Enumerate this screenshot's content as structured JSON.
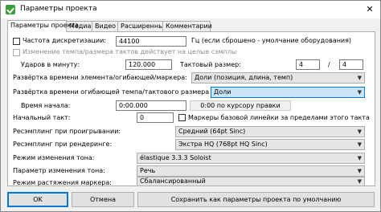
{
  "window": {
    "title": "Параметры проекта",
    "close": "✕"
  },
  "tabs": [
    "Параметры проекта",
    "Медиа",
    "Видео",
    "Расширенные",
    "Комментарии"
  ],
  "sample_rate": {
    "label": "Частота дискретизации:",
    "value": "44100",
    "hz_note": "Гц (если сброшено - умолчание оборудования)"
  },
  "tempo_change_note": "Изменение темпа/размера тактов действует на целые сэмплы",
  "bpm": {
    "label": "Ударов в минуту:",
    "value": "120.000"
  },
  "time_sig": {
    "label": "Тактовый размер:",
    "numerator": "4",
    "slash": "/",
    "denominator": "4"
  },
  "item_timebase": {
    "label": "Развёртка времени элемента/огибающей/маркера:",
    "value": "Доли (позиция, длина, темп)"
  },
  "envelope_timebase": {
    "label": "Развёртка времени огибающей темпа/тактового размера",
    "value": "Доли"
  },
  "start_time": {
    "label": "Время начала:",
    "value": "0:00.000",
    "button": "0:00 по курсору правки"
  },
  "start_measure": {
    "label": "Начальный такт:",
    "value": "0",
    "checkbox_label": "Маркеры базовой линейки за пределами этого такта"
  },
  "resample_play": {
    "label": "Ресэмплинг при проигрывании:",
    "value": "Средний (64pt Sinc)"
  },
  "resample_render": {
    "label": "Ресэмплинг при рендеринге:",
    "value": "Экстра HQ (768pt HQ Sinc)"
  },
  "pitch_mode": {
    "label": "Режим изменения тона:",
    "value": "élastique 3.3.3 Soloist"
  },
  "pitch_param": {
    "label": "Параметр изменения тона:",
    "value": "Речь"
  },
  "stretch_mode": {
    "label": "Режим растяжения маркера:",
    "value": "Сбалансированный"
  },
  "buttons": {
    "ok": "OK",
    "cancel": "Отмена",
    "save_default": "Сохранить как параметры проекта по умолчанию"
  }
}
